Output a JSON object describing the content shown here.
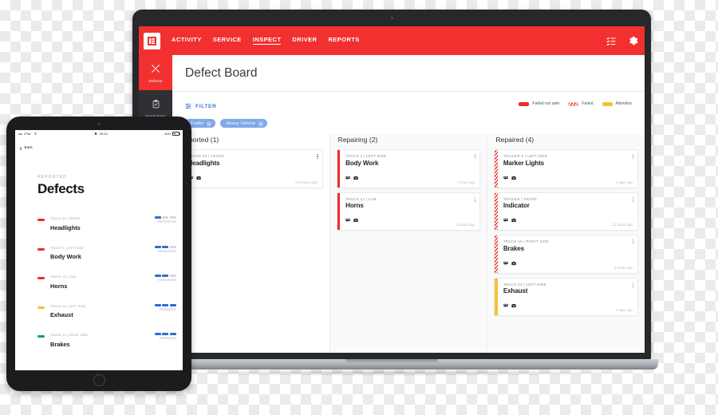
{
  "app": {
    "brand_color": "#F23030",
    "logo_icon": "logo-icon",
    "nav": [
      {
        "label": "ACTIVITY",
        "active": false
      },
      {
        "label": "SERVICE",
        "active": false
      },
      {
        "label": "INSPECT",
        "active": true
      },
      {
        "label": "DRIVER",
        "active": false
      },
      {
        "label": "REPORTS",
        "active": false
      }
    ],
    "nav_actions": [
      {
        "name": "checklist-icon",
        "label": "Checklist"
      },
      {
        "name": "gear-icon",
        "label": "Settings"
      }
    ]
  },
  "sidebar": {
    "items": [
      {
        "label": "Defects",
        "icon": "tools-icon",
        "active": true
      },
      {
        "label": "Inspections",
        "icon": "clipboard-check-icon",
        "active": false
      }
    ]
  },
  "page": {
    "title": "Defect Board"
  },
  "filter": {
    "label": "FILTER",
    "icon": "filter-icon",
    "chips": [
      {
        "label": "Trailer",
        "remove": "×"
      },
      {
        "label": "Heavy Vehicle",
        "remove": "×"
      }
    ]
  },
  "legend": {
    "items": [
      {
        "label": "Failed not safe",
        "style": "failednotsafe",
        "color": "#EE2B2B"
      },
      {
        "label": "Failed",
        "style": "failed",
        "color": "#EE2B2B"
      },
      {
        "label": "Attention",
        "style": "attention",
        "color": "#F5C133"
      }
    ]
  },
  "board": {
    "columns": [
      {
        "title": "Reported (1)",
        "cards": [
          {
            "vehicle": "TRUCK 54 | FRONT",
            "title": "Headlights",
            "time": "2 minutes ago",
            "severity": "failednotsafe",
            "icons": [
              "comment-icon",
              "camera-icon"
            ]
          }
        ]
      },
      {
        "title": "Repairing (2)",
        "cards": [
          {
            "vehicle": "TRUCK 2 | LEFT SIDE",
            "title": "Body Work",
            "time": "1 hour ago",
            "severity": "failednotsafe",
            "icons": [
              "comment-icon",
              "camera-icon"
            ]
          },
          {
            "vehicle": "TRUCK 12 | CAB",
            "title": "Horns",
            "time": "3 hours ago",
            "severity": "failednotsafe",
            "icons": [
              "comment-icon",
              "camera-icon"
            ]
          }
        ]
      },
      {
        "title": "Repaired (4)",
        "cards": [
          {
            "vehicle": "TRAILER 9 | LEFT SIDE",
            "title": "Marker Lights",
            "time": "2 days ago",
            "severity": "failed",
            "icons": [
              "comment-icon",
              "camera-icon"
            ]
          },
          {
            "vehicle": "TRAILER | FRONT",
            "title": "Indicator",
            "time": "12 hours ago",
            "severity": "failed",
            "icons": [
              "comment-icon",
              "camera-icon"
            ]
          },
          {
            "vehicle": "TRUCK 19 | RIGHT SIDE",
            "title": "Brakes",
            "time": "3 hours ago",
            "severity": "failed",
            "icons": [
              "comment-icon",
              "camera-icon"
            ]
          },
          {
            "vehicle": "TRUCK 24 | LEFT SIDE",
            "title": "Exhaust",
            "time": "2 days ago",
            "severity": "attention",
            "icons": [
              "comment-icon",
              "camera-icon"
            ]
          }
        ]
      }
    ]
  },
  "tablet": {
    "status": {
      "carrier": "iPad",
      "signal": "•••••",
      "wifi_icon": "wifi-icon",
      "lock_icon": "lock-icon",
      "time": "09:24",
      "battery_label": "40%"
    },
    "back": {
      "label": "Back",
      "icon": "chevron-left-icon"
    },
    "eyebrow": "REPORTED",
    "title": "Defects",
    "rows": [
      {
        "vehicle": "TRUCK 54 | FRONT",
        "title": "Headlights",
        "color": "#EE2B2B",
        "state": "REPORTED",
        "steps_done": 1,
        "steps_total": 3
      },
      {
        "vehicle": "TRUCK 2 | LEFT SIDE",
        "title": "Body Work",
        "color": "#EE2B2B",
        "state": "REPAIRING",
        "steps_done": 2,
        "steps_total": 3
      },
      {
        "vehicle": "TRUCK 12 | CAB",
        "title": "Horns",
        "color": "#EE2B2B",
        "state": "REPAIRING",
        "steps_done": 2,
        "steps_total": 3
      },
      {
        "vehicle": "TRUCK 24 | LEFT SIDE",
        "title": "Exhaust",
        "color": "#F5C133",
        "state": "REPAIRED",
        "steps_done": 3,
        "steps_total": 3
      },
      {
        "vehicle": "TRUCK 19 | RIGHT SIDE",
        "title": "Brakes",
        "color": "#12A05C",
        "state": "REPAIRED",
        "steps_done": 3,
        "steps_total": 3
      }
    ]
  }
}
